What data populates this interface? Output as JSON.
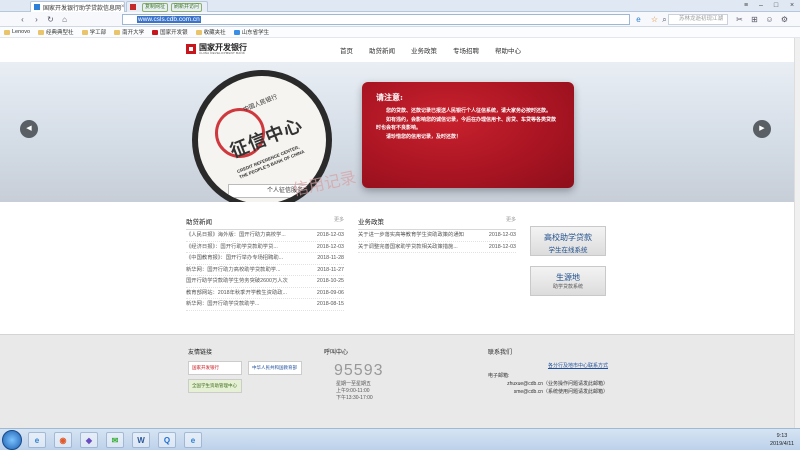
{
  "browser": {
    "tabs": [
      {
        "title": "国家开发银行助学贷款信息网",
        "active": true
      },
      {
        "title": "",
        "pills": [
          "复制网址",
          "刷新并访问"
        ],
        "active": false
      }
    ],
    "url": "www.csls.cdb.com.cn",
    "search_placeholder": "苏林龙逝初现江湖",
    "bookmarks": [
      "Lenovo",
      "经典典型社",
      "学工部",
      "南开大学",
      "国家开发银",
      "收藏夹社",
      "山东省学生"
    ]
  },
  "header": {
    "logo_name": "国家开发银行",
    "logo_sub": "CHINA DEVELOPMENT BANK",
    "menu": [
      "首页",
      "助贷新闻",
      "业务政策",
      "专场招聘",
      "帮助中心"
    ]
  },
  "banner": {
    "lens_arc": "中国人民银行",
    "lens_title": "征信中心",
    "lens_en_1": "CREDIT REFERENCE CENTER,",
    "lens_en_2": "THE PEOPLE'S BANK OF CHINA",
    "lens_bar": "个人征信服务",
    "ghost_text": "信用记录",
    "notice_title": "请注意:",
    "notice_lines": [
      "您的贷款、还款记录已报送人民银行个人征信系统，请大家务必按时还款。",
      "如有违约，会影响您的诚信记录，今后在办理信用卡、房贷、车贷等各类贷款时也会有不良影响。",
      "请珍惜您的信用记录，及时还款！"
    ],
    "prev_arrow": "◀",
    "next_arrow": "▶"
  },
  "news": {
    "title": "助贷新闻",
    "more": "更多",
    "items": [
      {
        "t": "《人民日报》海外版：国开行助力高校学...",
        "d": "2018-12-03"
      },
      {
        "t": "《经济日报》：国开行助学贷款助学贷...",
        "d": "2018-12-03"
      },
      {
        "t": "《中国教育报》：国开行举办专场招聘助...",
        "d": "2018-11-28"
      },
      {
        "t": "新华网：国开行助力高校助学贷款助学...",
        "d": "2018-11-27"
      },
      {
        "t": "国开行助学贷款助学生劳务突破2600万人次",
        "d": "2018-10-25"
      },
      {
        "t": "教育部网站：2018年秋季开学教生资助政...",
        "d": "2018-09-06"
      },
      {
        "t": "新华网：国开行助学贷款助学...",
        "d": "2018-08-15"
      }
    ]
  },
  "policy": {
    "title": "业务政策",
    "more": "更多",
    "items": [
      {
        "t": "关于进一步落实高等教育学生资助政策的通知",
        "d": "2018-12-03"
      },
      {
        "t": "关于调整完善国家助学贷款相关政策措施...",
        "d": "2018-12-03"
      }
    ]
  },
  "sidebuttons": [
    {
      "a": "高校助学贷款",
      "b": "学生在线系统",
      "c": ""
    },
    {
      "a": "生源地",
      "b": "",
      "c": "助学贷款系统"
    }
  ],
  "footer": {
    "links_title": "友情链接",
    "link_logos": [
      "国家开发银行",
      "中华人民共和国教育部",
      "全国学生资助管理中心"
    ],
    "hotline_title": "呼叫中心",
    "hotline": "95593",
    "hours_1": "星期一至星期五",
    "hours_2": "上午9:00-11:00",
    "hours_3": "下午13:30-17:00",
    "contact_title": "联系我们",
    "contact_link": "各分行及地市中心联系方式",
    "email_label": "电子邮箱:",
    "email_1": "zhuxue@cdb.cn（业务操作问题请发此邮箱）",
    "email_2": "sme@cdb.cn（系统使用问题请发此邮箱）"
  },
  "taskbar": {
    "time": "9:13",
    "date": "2019/4/11"
  }
}
